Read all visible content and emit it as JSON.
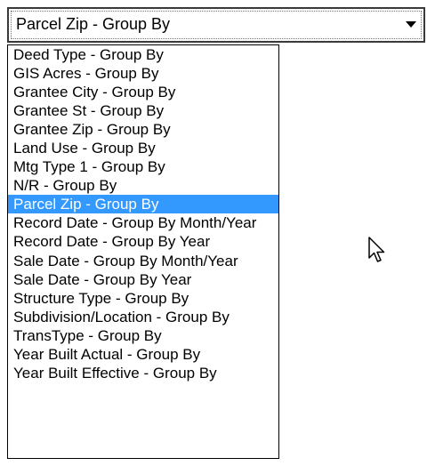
{
  "combo": {
    "value": "Parcel Zip - Group By",
    "icon": "chevron-down-icon"
  },
  "dropdown": {
    "selected_index": 8,
    "items": [
      {
        "label": "Deed Type - Group By"
      },
      {
        "label": "GIS Acres - Group By"
      },
      {
        "label": "Grantee City - Group By"
      },
      {
        "label": "Grantee St - Group By"
      },
      {
        "label": "Grantee Zip - Group By"
      },
      {
        "label": "Land Use - Group By"
      },
      {
        "label": "Mtg Type 1 - Group By"
      },
      {
        "label": "N/R - Group By"
      },
      {
        "label": "Parcel Zip - Group By"
      },
      {
        "label": "Record Date - Group By Month/Year"
      },
      {
        "label": "Record Date - Group By Year"
      },
      {
        "label": "Sale Date - Group By Month/Year"
      },
      {
        "label": "Sale Date - Group By Year"
      },
      {
        "label": "Structure Type - Group By"
      },
      {
        "label": "Subdivision/Location - Group By"
      },
      {
        "label": "TransType - Group By"
      },
      {
        "label": "Year Built Actual - Group By"
      },
      {
        "label": "Year Built Effective - Group By"
      }
    ]
  },
  "colors": {
    "selection_background": "#3399ff",
    "selection_text": "#ffffff"
  },
  "cursor": {
    "icon": "mouse-pointer-icon"
  }
}
